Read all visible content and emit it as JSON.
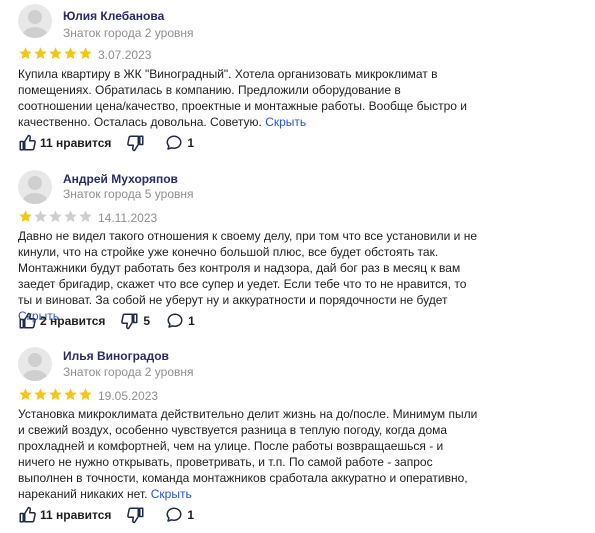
{
  "colors": {
    "star": "#f5c518",
    "star_empty": "#cfcfcf",
    "link": "#2a53c5",
    "name": "#2a2a66",
    "icon": "#1f2a44"
  },
  "reviews": [
    {
      "name": "Юлия Клебанова",
      "level": "Знаток города 2 уровня",
      "rating": 5,
      "date": "3.07.2023",
      "text": "Купила квартиру в ЖК \"Виноградный\". Хотела организовать микроклимат в помещениях. Обратилась в компанию. Предложили оборудование в соотношении цена/качество, проектные и монтажные работы. Вообще быстро и качественно. Осталась довольна. Советую.",
      "hide": "Скрыть",
      "likes": "11 нравится",
      "dislikes": "",
      "comments": "1"
    },
    {
      "name": "Андрей Мухоряпов",
      "level": "Знаток города 5 уровня",
      "rating": 1,
      "date": "14.11.2023",
      "text": "Давно не видел такого отношения к своему делу, при том что все установили и не кинули, что на стройке уже конечно большой плюс, все будет обстоять так. Монтажники будут работать без контроля и надзора, дай бог раз в месяц к вам заедет бригадир, скажет что все супер и уедет. Если тебе что то не нравится, то ты и виноват. За собой не уберут ну и аккуратности и порядочности не будет",
      "hide": "Скрыть",
      "likes": "2 нравится",
      "dislikes": "5",
      "comments": "1"
    },
    {
      "name": "Илья Виноградов",
      "level": "Знаток города 2 уровня",
      "rating": 5,
      "date": "19.05.2023",
      "text": "Установка микроклимата действительно делит жизнь на до/после. Минимум пыли и свежий воздух, особенно чувствуется разница в теплую погоду, когда дома прохладней и комфортней, чем на улице. После работы возвращаешься - и ничего не нужно открывать, проветривать, и т.п. По самой работе - запрос выполнен в точности, команда монтажников сработала аккуратно и оперативно, нареканий никаких нет.",
      "hide": "Скрыть",
      "likes": "11 нравится",
      "dislikes": "",
      "comments": "1"
    }
  ]
}
